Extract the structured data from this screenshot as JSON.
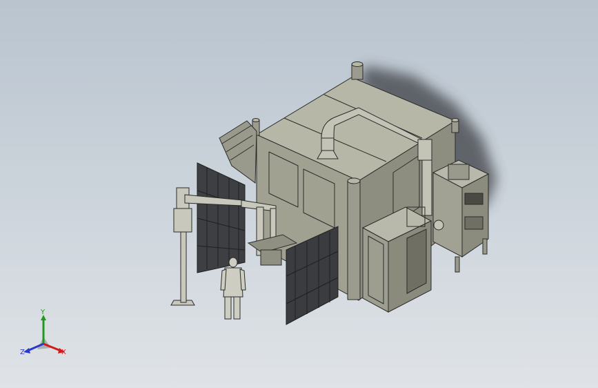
{
  "viewport": {
    "background_top": "#b9c4cf",
    "background_bottom": "#dfe3e7",
    "model_color": "#a3a394",
    "edge_color": "#2b2b2b"
  },
  "triad": {
    "x_label": "X",
    "y_label": "Y",
    "z_label": "Z",
    "x_color": "#d11a1a",
    "y_color": "#1f9a1f",
    "z_color": "#2b38c8"
  }
}
